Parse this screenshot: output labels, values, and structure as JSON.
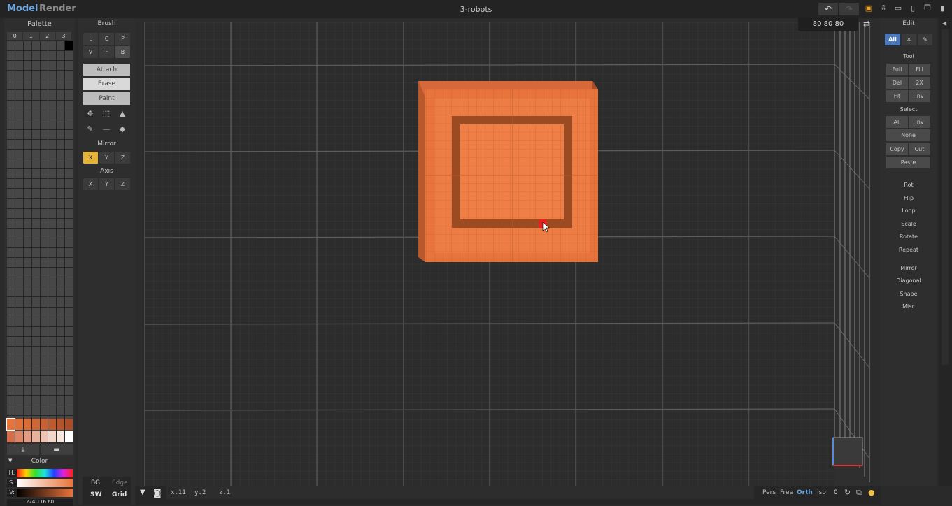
{
  "topbar": {
    "mode_model": "Model",
    "mode_render": "Render",
    "title": "3-robots",
    "undo_icon": "undo-icon",
    "redo_icon": "redo-icon",
    "icons": [
      "save-icon",
      "export-icon",
      "open-icon",
      "new-icon",
      "copy-icon",
      "delete-icon"
    ]
  },
  "palette": {
    "title": "Palette",
    "tabs": [
      "0",
      "1",
      "2",
      "3"
    ],
    "color_label": "Color",
    "h_label": "H:",
    "s_label": "S:",
    "v_label": "V:",
    "color_value": "224 116 60",
    "swatch_row1": [
      "#e8743c",
      "#e0713a",
      "#d96c38",
      "#d06635",
      "#c76032",
      "#bd5a2f",
      "#b4542c",
      "#aa4e29"
    ],
    "swatch_row2": [
      "#d46e4a",
      "#dc8668",
      "#e39c83",
      "#e9b09b",
      "#eec3b3",
      "#f3d5ca",
      "#f8e7e0",
      "#ffffff"
    ]
  },
  "brush": {
    "title": "Brush",
    "row1": [
      "L",
      "C",
      "P"
    ],
    "row2": [
      "V",
      "F",
      "B"
    ],
    "attach": "Attach",
    "erase": "Erase",
    "paint": "Paint",
    "mirror_title": "Mirror",
    "mirror": [
      "X",
      "Y",
      "Z"
    ],
    "axis_title": "Axis",
    "axis": [
      "X",
      "Y",
      "Z"
    ],
    "bg": "BG",
    "edge": "Edge",
    "sw": "SW",
    "grid": "Grid"
  },
  "viewport": {
    "dimensions": "80 80 80"
  },
  "status": {
    "x": "x.11",
    "y": "y.2",
    "z": "z.1",
    "pers": "Pers",
    "free": "Free",
    "orth": "Orth",
    "iso": "Iso",
    "zero": "0"
  },
  "edit": {
    "title": "Edit",
    "all": "All",
    "tool_title": "Tool",
    "tool": [
      "Full",
      "Fill",
      "Del",
      "2X",
      "Fit",
      "Inv"
    ],
    "select_title": "Select",
    "select": [
      "All",
      "Inv"
    ],
    "none": "None",
    "copy": "Copy",
    "cut": "Cut",
    "paste": "Paste",
    "ops": [
      "Rot",
      "Flip",
      "Loop",
      "Scale",
      "Rotate",
      "Repeat"
    ],
    "ops2": [
      "Mirror",
      "Diagonal",
      "Shape",
      "Misc"
    ]
  },
  "colors": {
    "accent": "#6aa6e0",
    "voxel": "#e8743c",
    "voxel_dark": "#9c4a22",
    "mirror_active": "#e4b33a"
  }
}
